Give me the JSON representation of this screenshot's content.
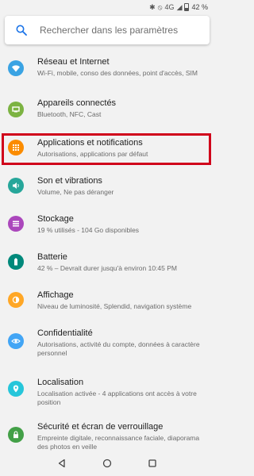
{
  "status_bar": {
    "network": "4G",
    "battery": "42 %"
  },
  "search": {
    "placeholder": "Rechercher dans les paramètres",
    "icon": "search-icon"
  },
  "colors": {
    "network": "#3aa3e3",
    "devices": "#7cb342",
    "apps": "#fb8c00",
    "sound": "#26a69a",
    "storage": "#ab47bc",
    "battery": "#00897b",
    "display": "#ffa726",
    "privacy": "#42a5f5",
    "location": "#26c6da",
    "security": "#43a047",
    "highlight": "#d0021b"
  },
  "settings": [
    {
      "title": "Réseau et Internet",
      "subtitle": "Wi-Fi, mobile, conso des données, point d'accès, SIM",
      "icon": "wifi-icon"
    },
    {
      "title": "Appareils connectés",
      "subtitle": "Bluetooth, NFC, Cast",
      "icon": "devices-icon"
    },
    {
      "title": "Applications et notifications",
      "subtitle": "Autorisations, applications par défaut",
      "icon": "apps-grid-icon"
    },
    {
      "title": "Son et vibrations",
      "subtitle": "Volume, Ne pas déranger",
      "icon": "volume-icon"
    },
    {
      "title": "Stockage",
      "subtitle": "19 % utilisés - 104 Go disponibles",
      "icon": "storage-icon"
    },
    {
      "title": "Batterie",
      "subtitle": "42 % – Devrait durer jusqu'à environ 10:45 PM",
      "icon": "battery-icon"
    },
    {
      "title": "Affichage",
      "subtitle": "Niveau de luminosité, Splendid, navigation système",
      "icon": "brightness-icon"
    },
    {
      "title": "Confidentialité",
      "subtitle": "Autorisations, activité du compte, données à caractère personnel",
      "icon": "eye-icon"
    },
    {
      "title": "Localisation",
      "subtitle": "Localisation activée - 4 applications ont accès à votre position",
      "icon": "location-pin-icon"
    },
    {
      "title": "Sécurité et écran de verrouillage",
      "subtitle": "Empreinte digitale, reconnaissance faciale, diaporama des photos en veille",
      "icon": "lock-icon"
    }
  ],
  "nav": {
    "back": "back-icon",
    "home": "home-icon",
    "recents": "recents-icon"
  }
}
